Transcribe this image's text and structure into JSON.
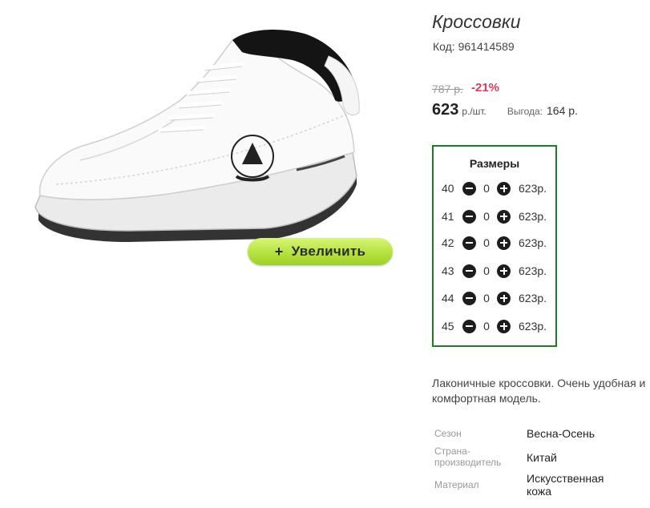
{
  "product": {
    "title": "Кроссовки",
    "code_label": "Код:",
    "code_value": "961414589"
  },
  "zoom_button": {
    "label": "Увеличить",
    "icon": "+"
  },
  "pricing": {
    "old_price": "787 р.",
    "discount": "-21%",
    "price": "623",
    "unit": "р./шт.",
    "benefit_label": "Выгода:",
    "benefit_value": "164 р."
  },
  "sizes": {
    "title": "Размеры",
    "rows": [
      {
        "size": "40",
        "qty": "0",
        "price": "623р."
      },
      {
        "size": "41",
        "qty": "0",
        "price": "623р."
      },
      {
        "size": "42",
        "qty": "0",
        "price": "623р."
      },
      {
        "size": "43",
        "qty": "0",
        "price": "623р."
      },
      {
        "size": "44",
        "qty": "0",
        "price": "623р."
      },
      {
        "size": "45",
        "qty": "0",
        "price": "623р."
      }
    ]
  },
  "description": {
    "line1": "Лаконичные кроссовки. Очень удобная и",
    "line2": "комфортная модель."
  },
  "properties": [
    {
      "label": "Сезон",
      "value": "Весна-Осень"
    },
    {
      "label_line1": "Страна-",
      "label_line2": "производитель",
      "value": "Китай"
    },
    {
      "label": "Материал",
      "value_line1": "Искусственная",
      "value_line2": "кожа"
    }
  ],
  "colors": {
    "sizes_border": "#1b7e1e",
    "discount": "#e2395a",
    "zoom_button": "#b5e23e"
  }
}
